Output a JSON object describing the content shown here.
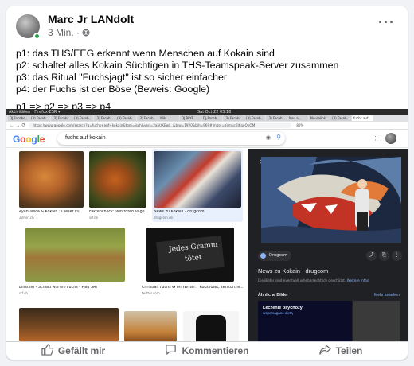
{
  "post": {
    "author": "Marc Jr LANdolt",
    "time": "3 Min.",
    "privacy_icon": "globe-icon",
    "lines": [
      "p1: das THS/EEG erkennt wenn Menschen auf Kokain sind",
      "p2: schaltet alles Kokain Süchtigen in THS-Teamspeak-Server zusammen",
      "p3: das Ritual \"Fuchsjagt\" ist so sicher einfacher",
      "p4: der Fuchs ist der Böse (Beweis: Google)"
    ],
    "conclusion": "p1 => p2 => p3 => p4"
  },
  "screenshot": {
    "os_bar": {
      "items": [
        "Aktivitäten",
        "Firefox-ESR ▾"
      ],
      "clock": "Sat Oct 22 03:18"
    },
    "tabs": [
      "DJ Facebo..",
      "(3) Faceb..",
      "(3) Faceb..",
      "(3) Faceb..",
      "(3) Faceb..",
      "(3) Faceb..",
      "(3) Faceb..",
      "Wiki...",
      "DJ PAYE..",
      "DJ Faceb..",
      "(3) Faceb..",
      "(3) Faceb..",
      "(3) Faceb..",
      "Neu a...",
      "Neuralink..",
      "(3) Faceb..",
      "fuchs auf.."
    ],
    "url": "https://www.google.com/search?q=fuchs+auf+kokain&tbm=isch&ved=2ahUKEwj...&biw=1920&bih=969#imgrc=Ycmuc6l6aoQpOM",
    "zoom": "80%",
    "google": {
      "logo_letters": [
        "G",
        "o",
        "o",
        "g",
        "l",
        "e"
      ],
      "logo_colors": [
        "#4285f4",
        "#ea4335",
        "#fbbc05",
        "#4285f4",
        "#34a853",
        "#ea4335"
      ],
      "query": "fuchs auf kokain"
    },
    "results": [
      {
        "title": "Ayahuasca & Kokain : Dieser Fu...",
        "source": "20min.ch"
      },
      {
        "title": "Faktencheck: Von toten Väge...",
        "source": "srf.de"
      },
      {
        "title": "News zu Kokain - drugcom",
        "source": "drugcom.de"
      },
      {
        "title": "Einstein - Schlau wie ein Fuchs - Play SRF",
        "source": "srf.ch"
      },
      {
        "title": "Christian Fuchs ✪ on Twitter: \"Koks lötet, zerstört N...",
        "source": "twitter.com"
      }
    ],
    "book_text": [
      "Jedes Gramm",
      "tötet"
    ],
    "panel": {
      "site": "Drugcom",
      "title": "News zu Kokain - drugcom",
      "subtitle": "Die Bilder sind eventuell urheberrechtlich geschützt.",
      "subtitle_link": "Weitere Infos",
      "related_heading": "Ähnliche Bilder",
      "more_link": "Mehr ansehen",
      "related_title": "Leczenie psychozy",
      "related_sub": "wspomagane dietą"
    }
  },
  "actions": {
    "like": "Gefällt mir",
    "comment": "Kommentieren",
    "share": "Teilen"
  }
}
